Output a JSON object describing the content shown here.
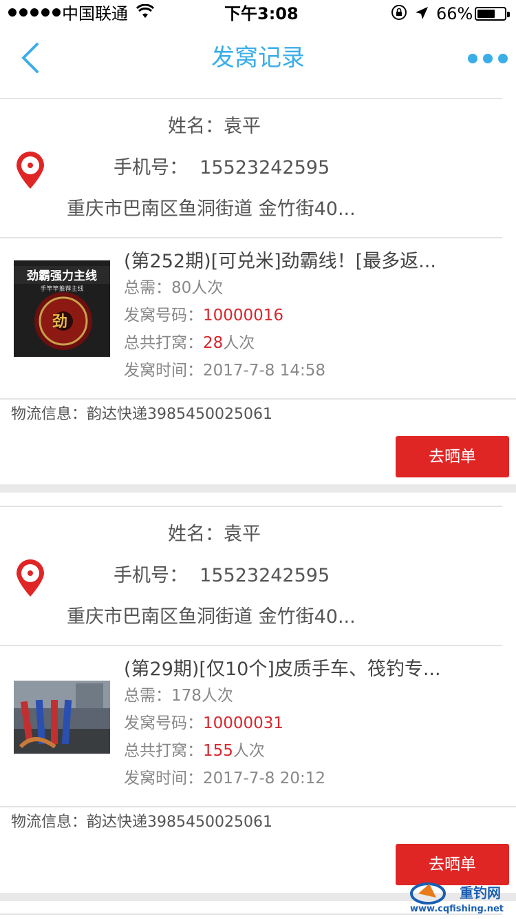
{
  "status": {
    "carrier": "中国联通",
    "time": "下午3:08",
    "battery": "66%",
    "battery_level": 0.66
  },
  "nav": {
    "title": "发窝记录",
    "back_icon": "chevron-left-icon",
    "more_icon": "more-dots-icon"
  },
  "labels": {
    "name": "姓名：",
    "phone": "手机号：",
    "total": "总需：",
    "code": "发窝号码：",
    "dawo": "总共打窝：",
    "time": "发窝时间：",
    "logistics": "物流信息：",
    "unit": "人次",
    "button": "去晒单"
  },
  "records": [
    {
      "name": "袁平",
      "phone": "15523242595",
      "address": "重庆市巴南区鱼洞街道 金竹街40...",
      "product_title": "(第252期)[可兑米]劲霸线！[最多返...",
      "product_image_text": "劲霸强力主线",
      "product_image_sub": "手竿竿推荐主线",
      "total_need": "80人次",
      "code": "10000016",
      "dawo_count": "28",
      "time": "2017-7-8 14:58",
      "logistics": "韵达快递3985450025061"
    },
    {
      "name": "袁平",
      "phone": "15523242595",
      "address": "重庆市巴南区鱼洞街道 金竹街40...",
      "product_title": "(第29期)[仅10个]皮质手车、筏钓专...",
      "total_need": "178人次",
      "code": "10000031",
      "dawo_count": "155",
      "time": "2017-7-8 20:12",
      "logistics": "韵达快递3985450025061"
    }
  ],
  "watermark": {
    "brand": "重钓网",
    "url": "www.cqfishing.net"
  },
  "colors": {
    "accent": "#3baee8",
    "red": "#e02525",
    "price_red": "#d9262c",
    "gap": "#e9e9e9"
  }
}
